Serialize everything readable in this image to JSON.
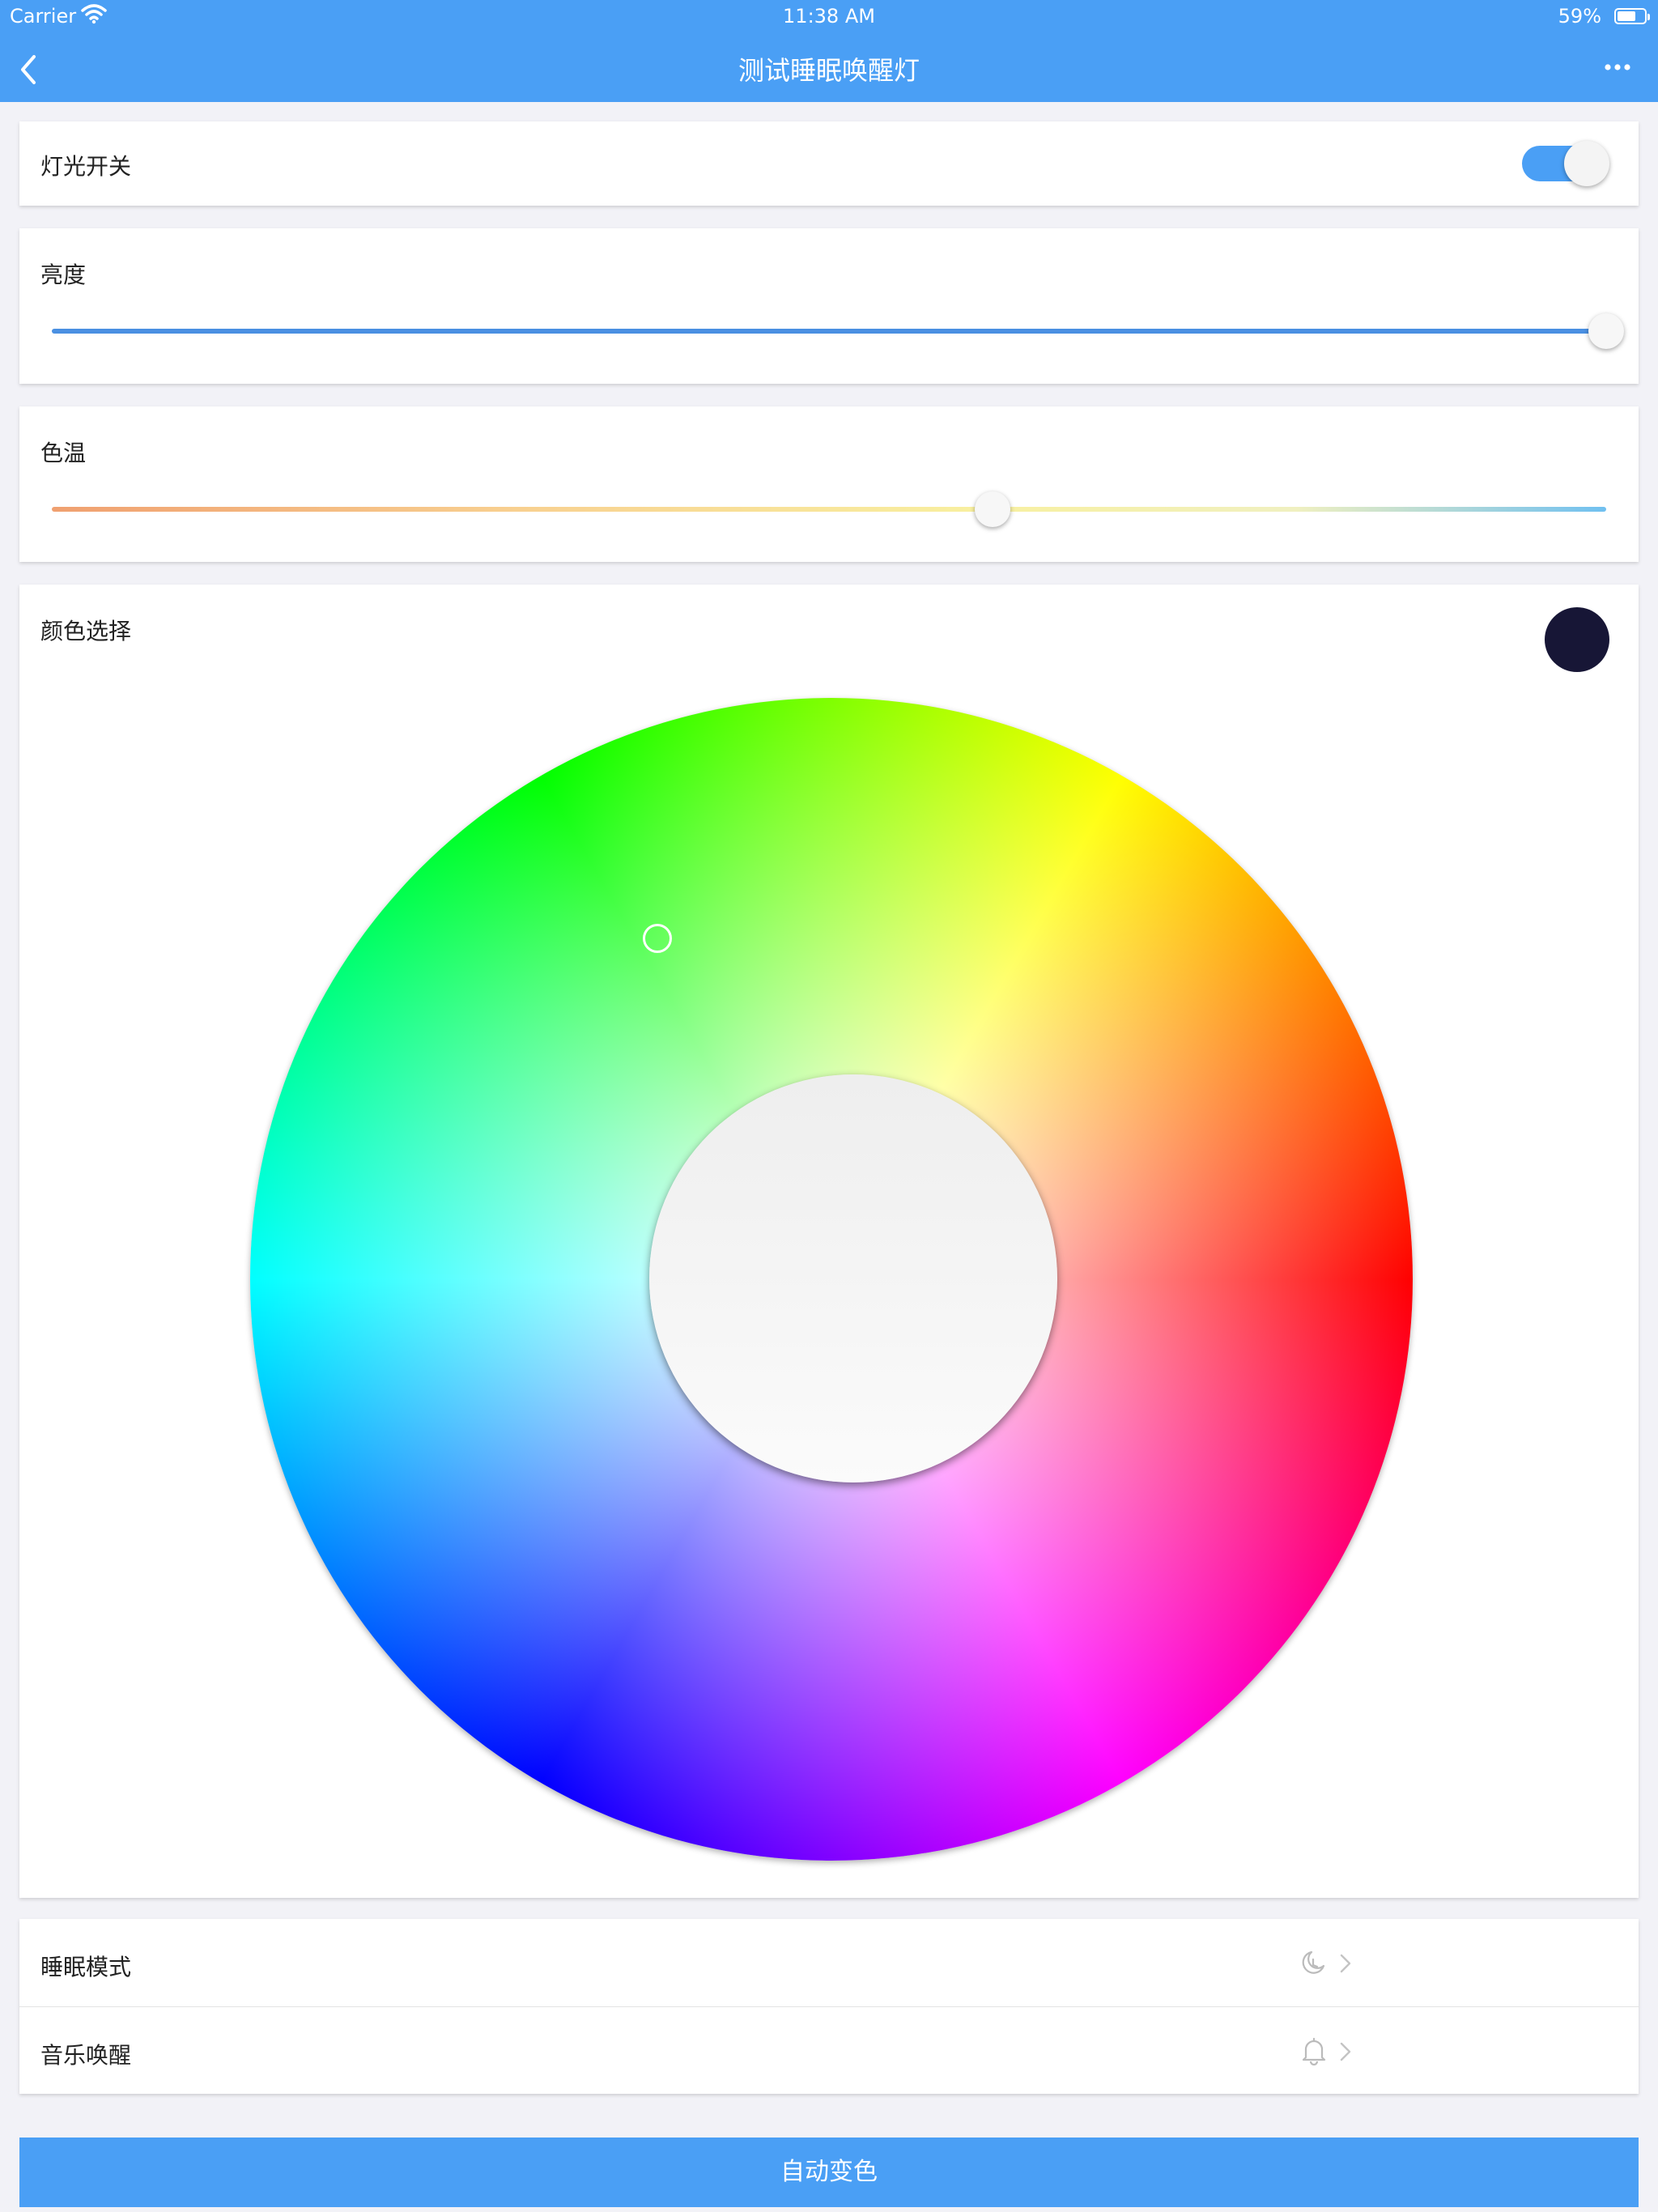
{
  "status_bar": {
    "carrier": "Carrier",
    "time": "11:38 AM",
    "battery": "59%"
  },
  "nav": {
    "title": "测试睡眠唤醒灯"
  },
  "light_switch": {
    "label": "灯光开关",
    "on": true
  },
  "brightness": {
    "label": "亮度",
    "value": 1.0
  },
  "color_temperature": {
    "label": "色温",
    "value": 0.605
  },
  "color_select": {
    "label": "颜色选择",
    "selected_color": "#171636"
  },
  "list": {
    "sleep_mode": {
      "label": "睡眠模式",
      "icon": "moon-clock-icon"
    },
    "music_wake": {
      "label": "音乐唤醒",
      "icon": "bell-icon"
    }
  },
  "auto_color_button": "自动变色",
  "colors": {
    "accent": "#4a9ff5",
    "background": "#f2f2f7"
  }
}
